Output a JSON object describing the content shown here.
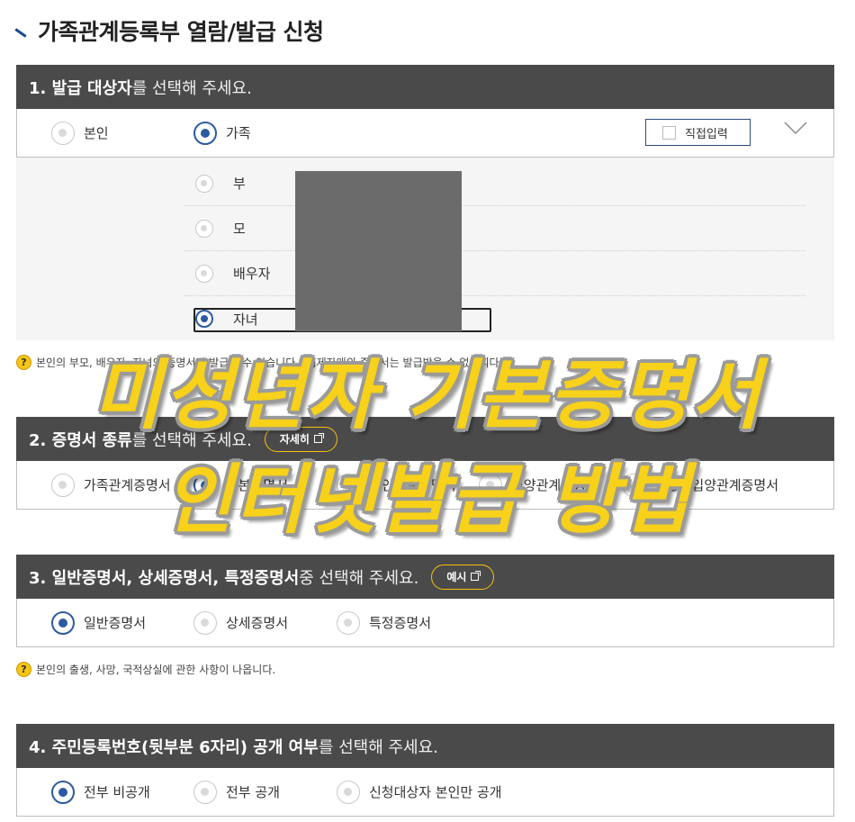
{
  "page": {
    "title": "가족관계등록부 열람/발급 신청"
  },
  "section1": {
    "header_bold": "1. 발급 대상자",
    "header_rest": "를 선택해 주세요.",
    "options": [
      {
        "label": "본인",
        "selected": false
      },
      {
        "label": "가족",
        "selected": true
      }
    ],
    "direct_input_label": "직접입력",
    "family": [
      {
        "label": "부",
        "selected": false
      },
      {
        "label": "모",
        "selected": false
      },
      {
        "label": "배우자",
        "selected": false
      },
      {
        "label": "자녀",
        "selected": true
      }
    ],
    "note": "본인의 부모, 배우자, 자녀의 증명서만 발급할 수 있습니다. (형제자매의 증명서는 발급받을 수 없습니다)"
  },
  "section2": {
    "header_bold": "2. 증명서 종류",
    "header_rest": "를 선택해 주세요.",
    "detail_button": "자세히",
    "options": [
      {
        "label": "가족관계증명서",
        "selected": false
      },
      {
        "label": "기본증명서",
        "selected": true
      },
      {
        "label": "혼인관계증명서",
        "selected": false
      },
      {
        "label": "입양관계증명서",
        "selected": false
      },
      {
        "label": "친양자입양관계증명서",
        "selected": false
      }
    ]
  },
  "section3": {
    "header_bold": "3. 일반증명서, 상세증명서, 특정증명서",
    "header_rest": " 중 선택해 주세요.",
    "example_button": "예시",
    "options": [
      {
        "label": "일반증명서",
        "selected": true
      },
      {
        "label": "상세증명서",
        "selected": false
      },
      {
        "label": "특정증명서",
        "selected": false
      }
    ],
    "note": "본인의 출생, 사망, 국적상실에 관한 사항이 나옵니다."
  },
  "section4": {
    "header_bold": "4. 주민등록번호(뒷부분 6자리) 공개 여부",
    "header_rest": "를 선택해 주세요.",
    "options": [
      {
        "label": "전부 비공개",
        "selected": true
      },
      {
        "label": "전부 공개",
        "selected": false
      },
      {
        "label": "신청대상자 본인만 공개",
        "selected": false
      }
    ]
  },
  "overlay": {
    "line1": "미성년자 기본증명서",
    "line2": "인터넷발급 방법"
  },
  "colors": {
    "header_bg": "#4a4a4a",
    "radio_selected": "#2c5aa0",
    "accent_yellow": "#f7d11a"
  },
  "icons": {
    "help": "question-circle-icon",
    "external": "external-link-icon",
    "expand": "chevron-down-icon"
  }
}
